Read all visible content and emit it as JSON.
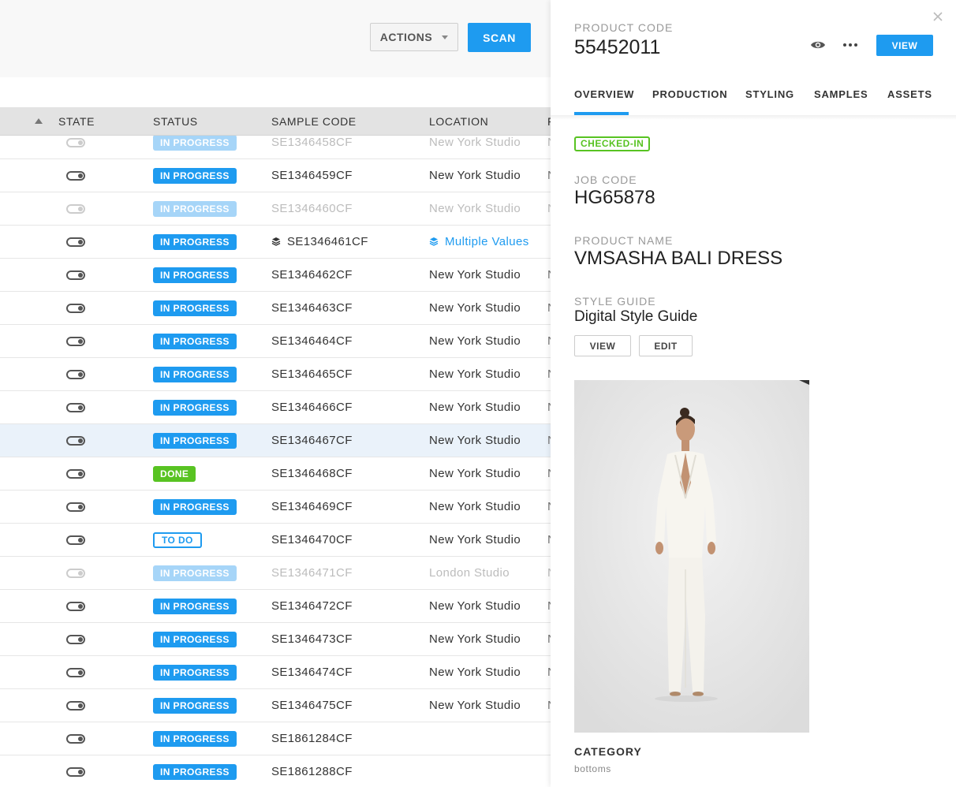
{
  "toolbar": {
    "actions_label": "ACTIONS",
    "scan_label": "SCAN"
  },
  "table": {
    "columns": [
      "STATE",
      "STATUS",
      "SAMPLE CODE",
      "LOCATION",
      "F"
    ],
    "rows": [
      {
        "status": "IN PROGRESS",
        "code": "SE1346458CF",
        "location": "New York Studio",
        "extra": "N",
        "faded": true
      },
      {
        "status": "IN PROGRESS",
        "code": "SE1346459CF",
        "location": "New York Studio",
        "extra": "N"
      },
      {
        "status": "IN PROGRESS",
        "code": "SE1346460CF",
        "location": "New York Studio",
        "extra": "N",
        "faded": true
      },
      {
        "status": "IN PROGRESS",
        "code": "SE1346461CF",
        "location": "Multiple Values",
        "extra": "",
        "multi": true
      },
      {
        "status": "IN PROGRESS",
        "code": "SE1346462CF",
        "location": "New York Studio",
        "extra": "N"
      },
      {
        "status": "IN PROGRESS",
        "code": "SE1346463CF",
        "location": "New York Studio",
        "extra": "N"
      },
      {
        "status": "IN PROGRESS",
        "code": "SE1346464CF",
        "location": "New York Studio",
        "extra": "N"
      },
      {
        "status": "IN PROGRESS",
        "code": "SE1346465CF",
        "location": "New York Studio",
        "extra": "N"
      },
      {
        "status": "IN PROGRESS",
        "code": "SE1346466CF",
        "location": "New York Studio",
        "extra": "N"
      },
      {
        "status": "IN PROGRESS",
        "code": "SE1346467CF",
        "location": "New York Studio",
        "extra": "N",
        "selected": true
      },
      {
        "status": "DONE",
        "code": "SE1346468CF",
        "location": "New York Studio",
        "extra": "N"
      },
      {
        "status": "IN PROGRESS",
        "code": "SE1346469CF",
        "location": "New York Studio",
        "extra": "N"
      },
      {
        "status": "TO DO",
        "code": "SE1346470CF",
        "location": "New York Studio",
        "extra": "N"
      },
      {
        "status": "IN PROGRESS",
        "code": "SE1346471CF",
        "location": "London Studio",
        "extra": "N",
        "faded": true
      },
      {
        "status": "IN PROGRESS",
        "code": "SE1346472CF",
        "location": "New York Studio",
        "extra": "N"
      },
      {
        "status": "IN PROGRESS",
        "code": "SE1346473CF",
        "location": "New York Studio",
        "extra": "N"
      },
      {
        "status": "IN PROGRESS",
        "code": "SE1346474CF",
        "location": "New York Studio",
        "extra": "N"
      },
      {
        "status": "IN PROGRESS",
        "code": "SE1346475CF",
        "location": "New York Studio",
        "extra": "N"
      },
      {
        "status": "IN PROGRESS",
        "code": "SE1861284CF",
        "location": "",
        "extra": ""
      },
      {
        "status": "IN PROGRESS",
        "code": "SE1861288CF",
        "location": "",
        "extra": ""
      }
    ]
  },
  "panel": {
    "product_code_label": "PRODUCT CODE",
    "product_code": "55452011",
    "view_label": "VIEW",
    "tabs": [
      "OVERVIEW",
      "PRODUCTION",
      "STYLING",
      "SAMPLES",
      "ASSETS"
    ],
    "active_tab": "OVERVIEW",
    "checked_in": "CHECKED-IN",
    "job_code_label": "JOB CODE",
    "job_code": "HG65878",
    "product_name_label": "PRODUCT NAME",
    "product_name": "VMSASHA BALI DRESS",
    "style_guide_label": "STYLE GUIDE",
    "style_guide": "Digital Style Guide",
    "style_view": "VIEW",
    "style_edit": "EDIT",
    "category_label": "CATEGORY",
    "category": "bottoms"
  },
  "colors": {
    "accent": "#1e9bf0",
    "done": "#58c322",
    "header_bg": "#e3e3e3",
    "selected_row": "#eaf2fa"
  }
}
